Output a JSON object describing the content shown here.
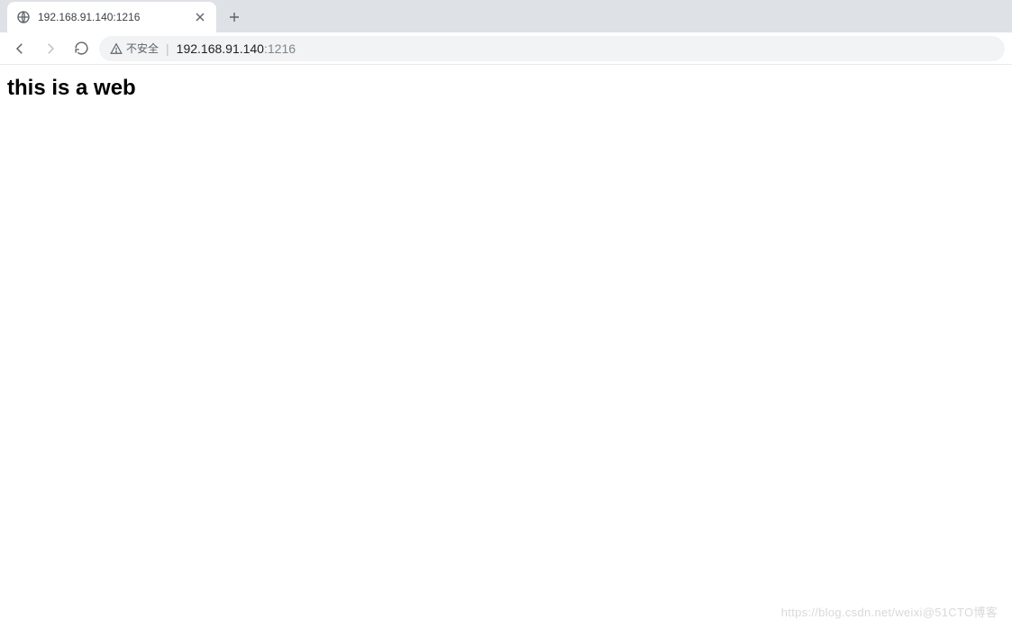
{
  "tab": {
    "title": "192.168.91.140:1216"
  },
  "addressbar": {
    "security_label": "不安全",
    "host": "192.168.91.140",
    "port": ":1216"
  },
  "page": {
    "heading": "this is a web"
  },
  "watermark": {
    "text_left": "https://blog.csdn.net/weixi",
    "text_right": "@51CTO博客"
  }
}
